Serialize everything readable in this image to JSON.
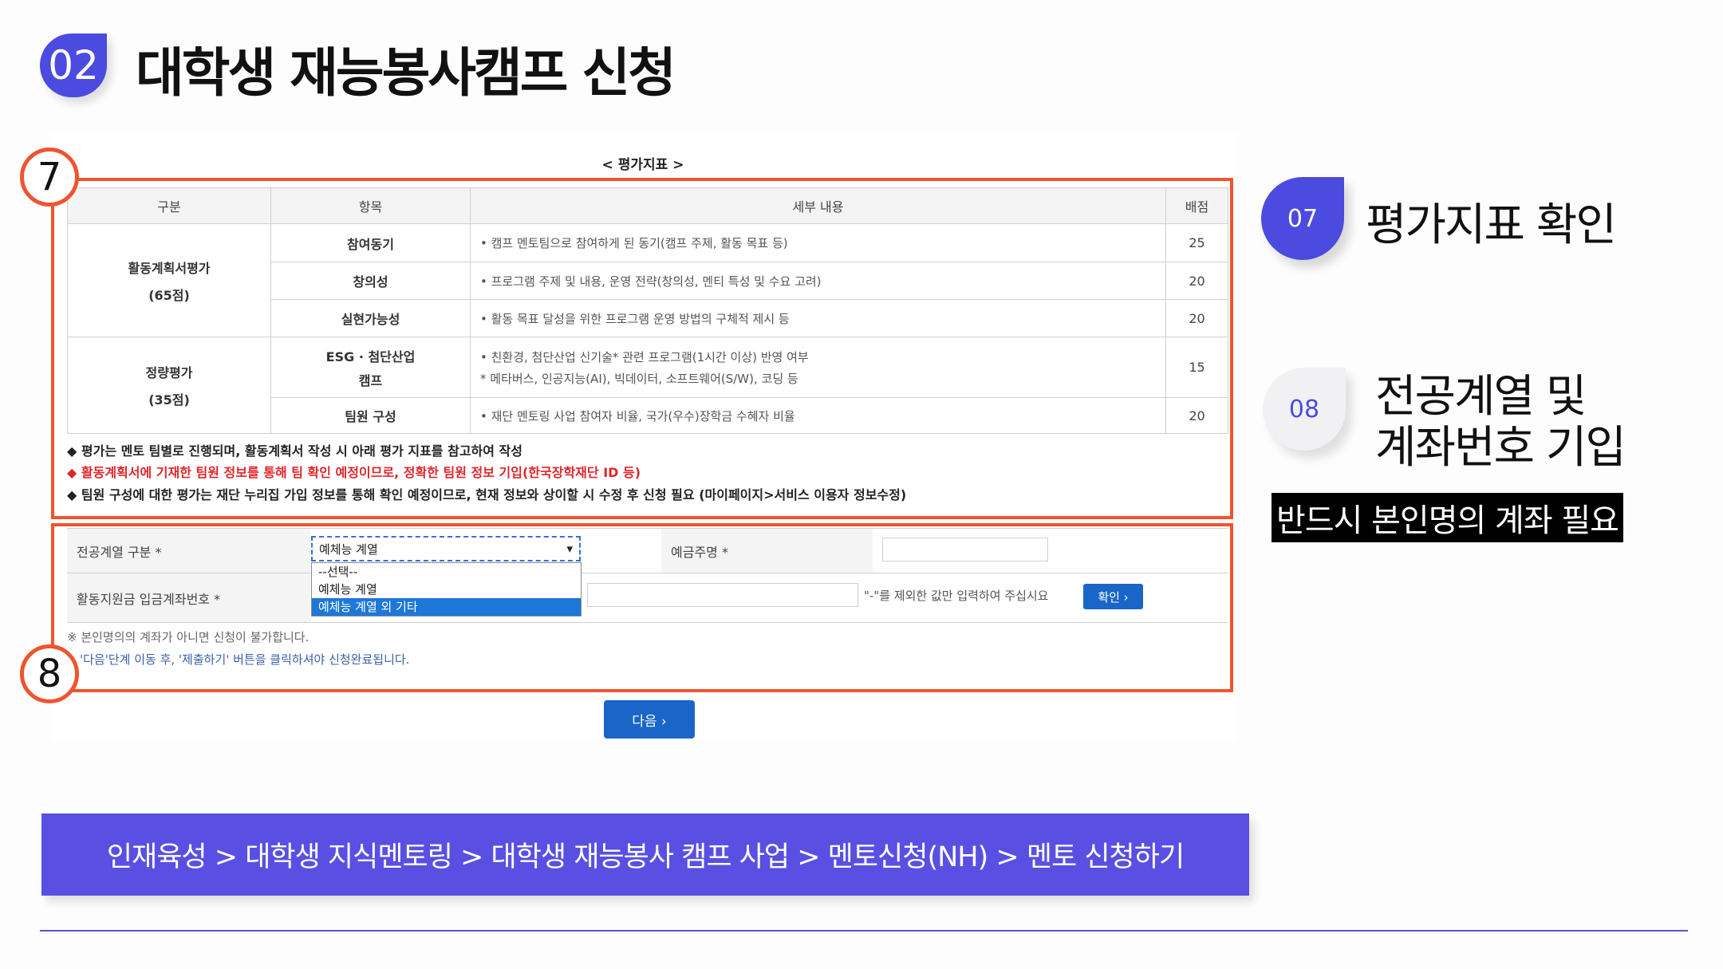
{
  "slide": {
    "number": "02",
    "title": "대학생 재능봉사캠프 신청"
  },
  "panel": {
    "title": "< 평가지표 >",
    "markers": {
      "seven": "7",
      "eight": "8"
    },
    "table": {
      "headers": [
        "구분",
        "항목",
        "세부 내용",
        "배점"
      ],
      "group1": {
        "name": "활동계획서평가",
        "sub": "(65점)"
      },
      "group2": {
        "name": "정량평가",
        "sub": "(35점)"
      },
      "rows": [
        {
          "item": "참여동기",
          "detail": "• 캠프 멘토팀으로 참여하게 된 동기(캠프 주제, 활동 목표 등)",
          "score": "25"
        },
        {
          "item": "창의성",
          "detail": "• 프로그램 주제 및 내용, 운영 전략(창의성, 멘티 특성 및 수요 고려)",
          "score": "20"
        },
        {
          "item": "실현가능성",
          "detail": "• 활동 목표 달성을 위한 프로그램 운영 방법의 구체적 제시 등",
          "score": "20"
        },
        {
          "item": "ESG · 첨단산업",
          "item2": "캠프",
          "detail": "• 친환경, 첨단산업 신기술* 관련 프로그램(1시간 이상) 반영 여부",
          "detail2": "*  메타버스, 인공지능(AI), 빅데이터, 소프트웨어(S/W), 코딩 등",
          "score": "15"
        },
        {
          "item": "팀원 구성",
          "detail": "• 재단 멘토링 사업 참여자 비율, 국가(우수)장학금 수혜자 비율",
          "score": "20"
        }
      ]
    },
    "notes": [
      "◆ 평가는 멘토 팀별로 진행되며, 활동계획서 작성 시 아래 평가 지표를 참고하여 작성",
      "◆ 활동계획서에 기재한 팀원 정보를 통해 팀 확인 예정이므로, 정확한 팀원 정보 기입(한국장학재단 ID 등)",
      "◆ 팀원 구성에 대한 평가는 재단 누리집 가입 정보를 통해 확인 예정이므로, 현재 정보와 상이할 시 수정 후 신청 필요 (마이페이지>서비스 이용자 정보수정)"
    ],
    "form": {
      "major_label": "전공계열 구분 *",
      "major_selected": "예체능 계열",
      "major_options": [
        "--선택--",
        "예체능 계열",
        "예체능 계열 외 기타"
      ],
      "depositor_label": "예금주명 *",
      "account_label": "활동지원금 입금계좌번호 *",
      "account_hint": "\"-\"를 제외한 값만 입력하여 주십시요",
      "confirm_label": "확인 ›",
      "footnote1": "※ 본인명의의 계좌가 아니면 신청이 불가합니다.",
      "footnote2": "'다음'단계 이동 후, '제출하기' 버튼을 클릭하셔야 신청완료됩니다."
    },
    "next_label": "다음   ›"
  },
  "side": {
    "step07": {
      "num": "07",
      "label": "평가지표 확인"
    },
    "step08": {
      "num": "08",
      "label1": "전공계열 및",
      "label2": "계좌번호 기입"
    },
    "warning": "반드시 본인명의 계좌 필요"
  },
  "breadcrumb": "인재육성 > 대학생 지식멘토링 > 대학생 재능봉사 캠프 사업 > 멘토신청(NH) > 멘토 신청하기",
  "colors": {
    "accent": "#4b4be0",
    "highlight": "#ee5430",
    "button": "#1a66c8",
    "note_red": "#e0262a"
  }
}
